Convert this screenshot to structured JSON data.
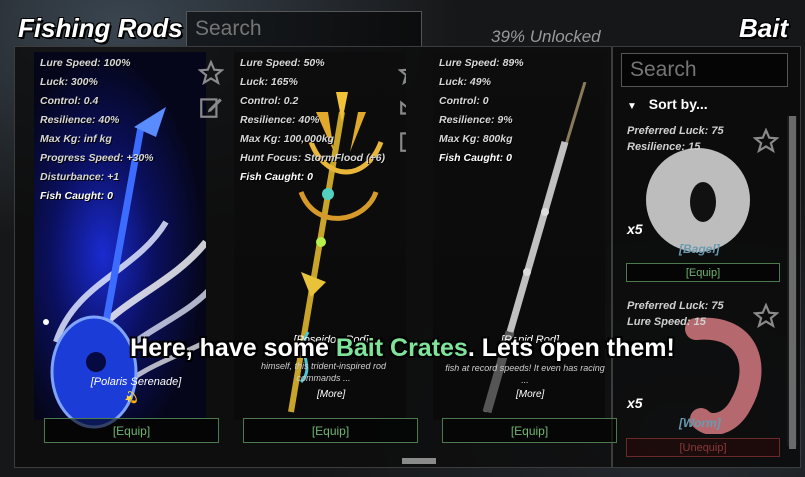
{
  "rods_header": {
    "title": "Fishing Rods",
    "search_placeholder": "Search",
    "unlocked": "39% Unlocked"
  },
  "bait_header": {
    "title": "Bait",
    "search_placeholder": "Search",
    "sort_label": "Sort by..."
  },
  "rods": [
    {
      "stats": [
        "Lure Speed: 100%",
        "Luck: 300%",
        "Control: 0.4",
        "Resilience: 40%",
        "Max Kg: inf kg",
        "Progress Speed: +30%",
        "Disturbance: +1"
      ],
      "fish_caught": "Fish Caught: 0",
      "name": "[Polaris Serenade]",
      "badge": "💫",
      "equip_label": "[Equip]"
    },
    {
      "stats": [
        "Lure Speed: 50%",
        "Luck: 165%",
        "Control: 0.2",
        "Resilience: 40%",
        "Max Kg: 100,000kg",
        "Hunt Focus: StormFlood (+6)"
      ],
      "fish_caught": "Fish Caught: 0",
      "name": "[Poseidon Rod]",
      "desc": "himself, this trident-inspired rod commands ...",
      "more": "[More]",
      "equip_label": "[Equip]"
    },
    {
      "stats": [
        "Lure Speed: 89%",
        "Luck: 49%",
        "Control: 0",
        "Resilience: 9%",
        "Max Kg: 800kg"
      ],
      "fish_caught": "Fish Caught: 0",
      "name": "[Rapid Rod]",
      "desc": "fish at record speeds! It even has racing ...",
      "more": "[More]",
      "equip_label": "[Equip]"
    }
  ],
  "baits": [
    {
      "stats": [
        "Preferred Luck: 75",
        "Resilience: 15"
      ],
      "count": "x5",
      "name": "[Bagel]",
      "button": "[Equip]"
    },
    {
      "stats": [
        "Preferred Luck: 75",
        "Lure Speed: 15"
      ],
      "count": "x5",
      "name": "[Worm]",
      "button": "[Unequip]"
    }
  ],
  "caption": {
    "before": "Here, have some ",
    "highlight": "Bait Crates",
    "after": ". Lets open them!"
  },
  "colors": {
    "equip_green": "#6fb46f",
    "caption_highlight": "#7fe39a",
    "unequip_red": "#8a3a3a"
  }
}
